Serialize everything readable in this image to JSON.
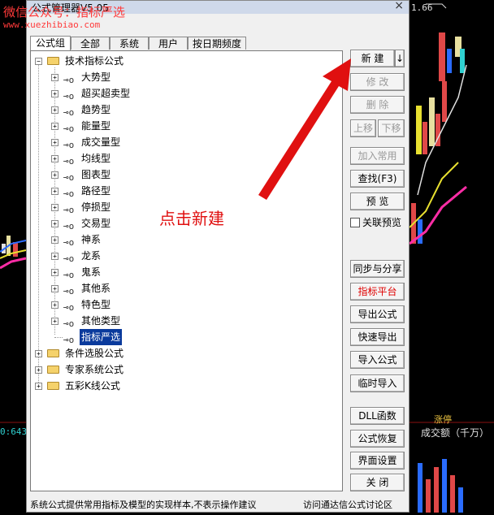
{
  "watermark": {
    "line1": "微信公众号：指标严选",
    "line2": "www.xuezhibiao.com"
  },
  "background": {
    "left_value": "0:643",
    "top_right_value": "1.66",
    "right_label": "成交额（千万）",
    "right_small": "涨停"
  },
  "dialog": {
    "title": "公式管理器V5.05",
    "close": "×",
    "tabs": [
      "公式组",
      "全部",
      "系统",
      "用户",
      "按日期频度"
    ],
    "tree": {
      "root": "技术指标公式",
      "children": [
        "大势型",
        "超买超卖型",
        "趋势型",
        "能量型",
        "成交量型",
        "均线型",
        "图表型",
        "路径型",
        "停损型",
        "交易型",
        "神系",
        "龙系",
        "鬼系",
        "其他系",
        "特色型",
        "其他类型",
        "指标严选"
      ],
      "selected": "指标严选",
      "others": [
        "条件选股公式",
        "专家系统公式",
        "五彩K线公式"
      ]
    },
    "buttons": {
      "new": "新  建",
      "new_drop": "↓",
      "edit": "修  改",
      "delete": "删  除",
      "move_up": "上移",
      "move_down": "下移",
      "add_common": "加入常用",
      "find": "查找(F3)",
      "preview": "预  览",
      "related_preview": "关联预览",
      "sync_share": "同步与分享",
      "indicator_platform": "指标平台",
      "export": "导出公式",
      "quick_export": "快速导出",
      "import": "导入公式",
      "temp_import": "临时导入",
      "dll": "DLL函数",
      "restore": "公式恢复",
      "ui_settings": "界面设置",
      "close": "关  闭"
    },
    "annotation": "点击新建",
    "status_left": "系统公式提供常用指标及模型的实现样本,不表示操作建议",
    "status_right": "访问通达信公式讨论区"
  },
  "colors": {
    "annotation": "#e01010",
    "selection": "#0a3a9c",
    "watermark": "#ff3a3a"
  }
}
